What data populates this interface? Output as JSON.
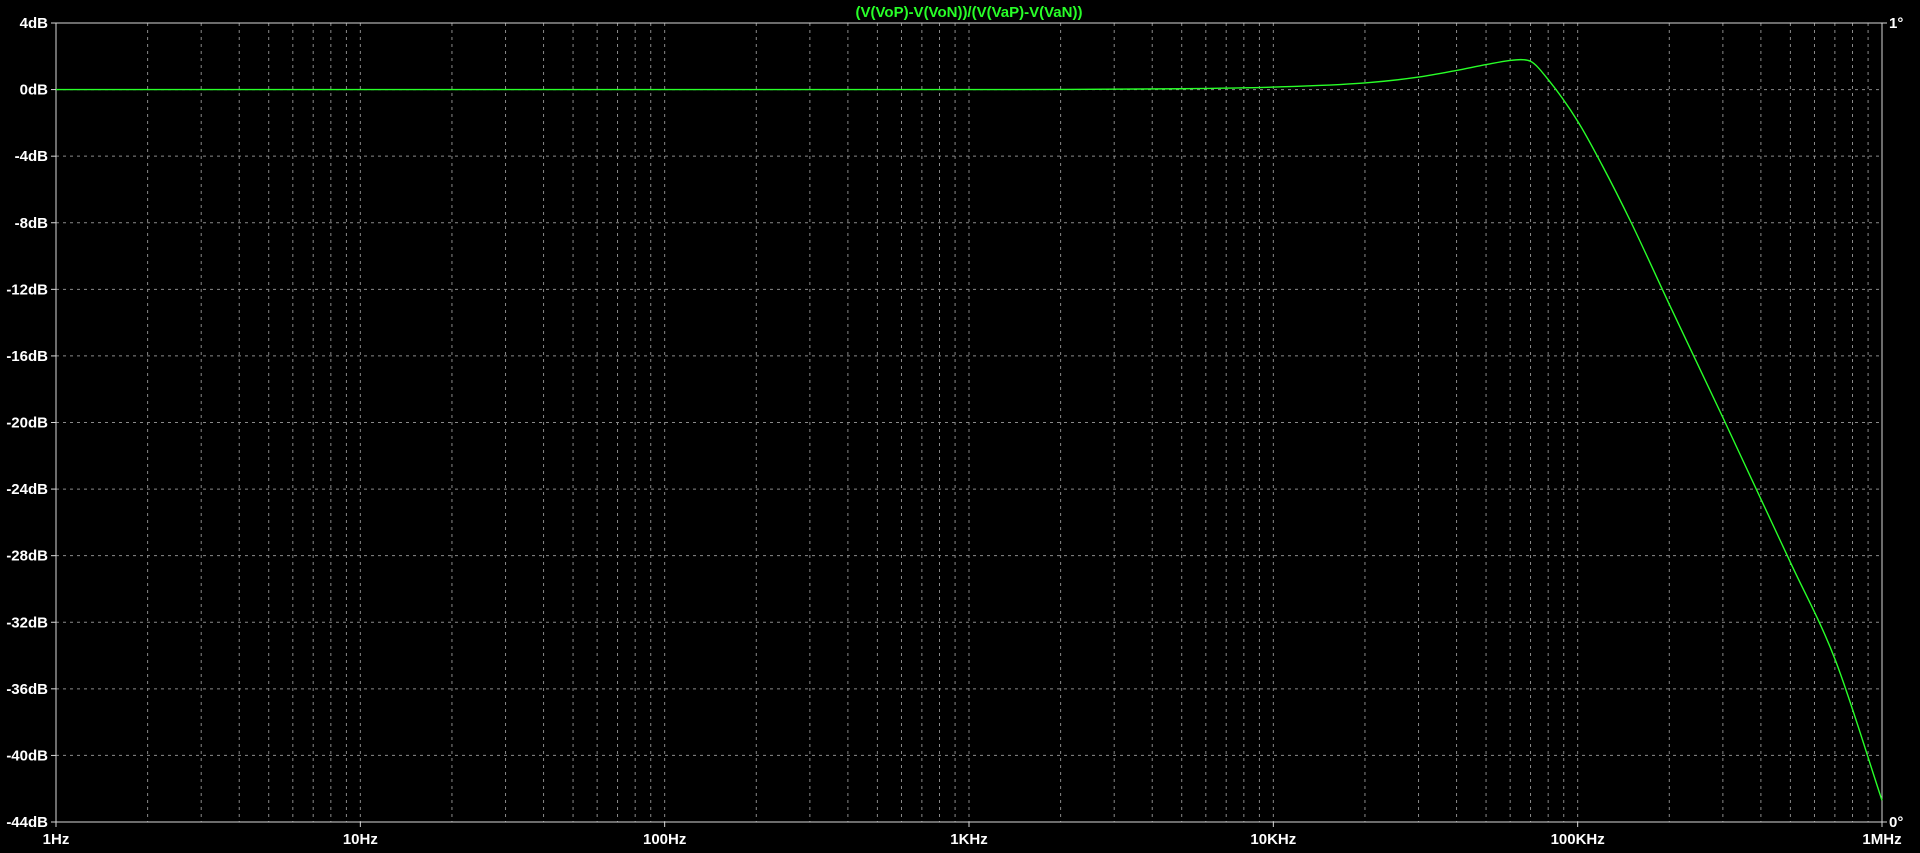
{
  "chart_data": {
    "type": "line",
    "title": "(V(VoP)-V(VoN))/(V(VaP)-V(VaN))",
    "xlabel": "",
    "ylabel": "",
    "x_scale": "log",
    "xlim": [
      "1Hz",
      "1MHz"
    ],
    "ylim": [
      -44,
      4
    ],
    "grid": true,
    "x_tick_labels": [
      "1Hz",
      "10Hz",
      "100Hz",
      "1KHz",
      "10KHz",
      "100KHz",
      "1MHz"
    ],
    "y_tick_labels": [
      "4dB",
      "0dB",
      "-4dB",
      "-8dB",
      "-12dB",
      "-16dB",
      "-20dB",
      "-24dB",
      "-28dB",
      "-32dB",
      "-36dB",
      "-40dB",
      "-44dB"
    ],
    "y2_tick_labels": [
      "1°",
      "0°"
    ],
    "series": [
      {
        "x_unit": "Hz",
        "y_unit": "dB",
        "x": [
          1,
          10,
          100,
          1000,
          5000,
          10000,
          20000,
          30000,
          40000,
          50000,
          60000,
          65000,
          70000,
          80000,
          100000,
          120000,
          150000,
          200000,
          300000,
          500000,
          700000,
          1000000
        ],
        "values": [
          0,
          0,
          0,
          0,
          0.05,
          0.15,
          0.4,
          0.75,
          1.15,
          1.5,
          1.75,
          1.8,
          1.7,
          0.6,
          -1.9,
          -4.5,
          -8.0,
          -12.9,
          -19.7,
          -28.4,
          -34.2,
          -42.7
        ]
      }
    ]
  },
  "colors": {
    "background": "#000000",
    "axis": "#d8d8d8",
    "grid": "#8a8a8a",
    "trace": "#28ff28",
    "title": "#28ff28",
    "label": "#ffffff"
  }
}
